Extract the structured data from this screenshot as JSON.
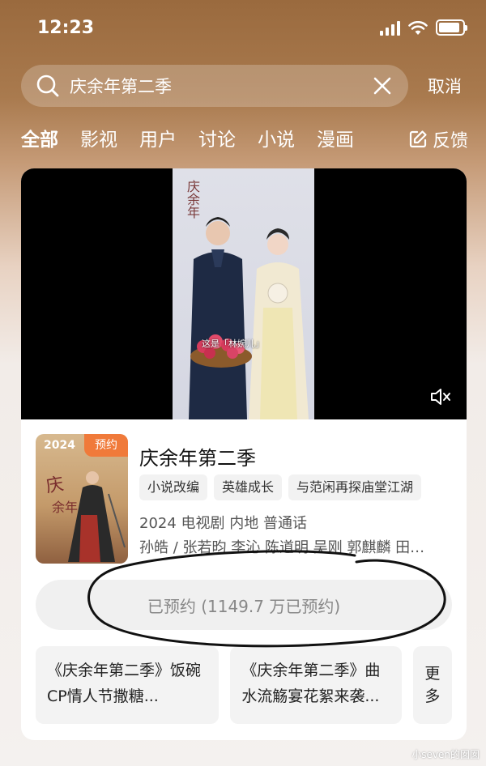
{
  "status_bar": {
    "time": "12:23",
    "battery_level": 0.9
  },
  "search": {
    "query": "庆余年第二季",
    "cancel_label": "取消"
  },
  "tabs": [
    {
      "label": "全部",
      "active": true
    },
    {
      "label": "影视",
      "active": false
    },
    {
      "label": "用户",
      "active": false
    },
    {
      "label": "讨论",
      "active": false
    },
    {
      "label": "小说",
      "active": false
    },
    {
      "label": "漫画",
      "active": false
    }
  ],
  "feedback_label": "反馈",
  "video": {
    "calligraphy": "庆余年",
    "subtitle": "这是「林婉儿」"
  },
  "show": {
    "poster_year": "2024",
    "poster_badge": "预约",
    "title": "庆余年第二季",
    "tags": [
      "小说改编",
      "英雄成长",
      "与范闲再探庙堂江湖"
    ],
    "meta": "2024 电视剧 内地 普通话",
    "cast": "孙皓 / 张若昀 李沁 陈道明 吴刚 郭麒麟 田…"
  },
  "reserve_button": "已预约 (1149.7 万已预约)",
  "related": [
    {
      "text": "《庆余年第二季》饭碗CP情人节撒糖..."
    },
    {
      "text": "《庆余年第二季》曲水流觞宴花絮来袭..."
    }
  ],
  "more_label": "更多",
  "watermark": "小seven的囡囡",
  "colors": {
    "accent_orange": "#f07a3a",
    "header_brown": "#9a6a3e"
  }
}
